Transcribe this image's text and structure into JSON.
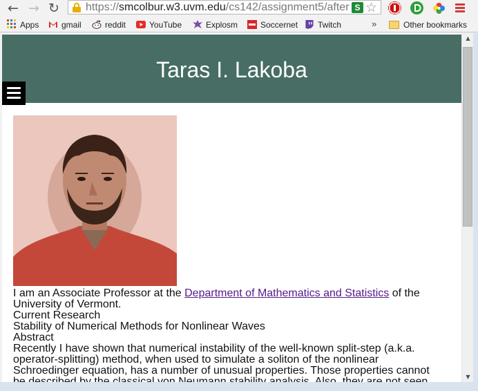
{
  "browser": {
    "url_scheme": "https://",
    "url_host": "smcolbur.w3.uvm.edu",
    "url_path": "/cs142/assignment5/after",
    "ext_green_label": "S",
    "icons": {
      "back": "back-arrow-icon",
      "forward": "forward-arrow-icon",
      "reload": "reload-icon",
      "lock": "lock-icon",
      "star": "star-icon"
    }
  },
  "bookmarks": {
    "items": [
      {
        "label": "Apps",
        "icon": "apps-grid-icon"
      },
      {
        "label": "gmail",
        "icon": "gmail-icon"
      },
      {
        "label": "reddit",
        "icon": "reddit-icon"
      },
      {
        "label": "YouTube",
        "icon": "youtube-icon"
      },
      {
        "label": "Explosm",
        "icon": "explosm-icon"
      },
      {
        "label": "Soccernet",
        "icon": "soccernet-icon"
      },
      {
        "label": "Twitch",
        "icon": "twitch-icon"
      }
    ],
    "overflow": "»",
    "other": "Other bookmarks"
  },
  "page": {
    "title": "Taras I. Lakoba",
    "intro_before": "I am an Associate Professor at the ",
    "intro_link": "Department of Mathematics and Statistics",
    "intro_after": " of the University of Vermont.",
    "heading_research": "Current Research",
    "research_title": "Stability of Numerical Methods for Nonlinear Waves",
    "heading_abstract": "Abstract",
    "abstract": "Recently I have shown that numerical instability of the well-known split-step (a.k.a. operator-splitting) method, when used to simulate a soliton of the nonlinear Schroedinger equation, has a number of unusual properties. Those properties cannot be described by the classical von Neumann stability analysis. Also, they are not seen"
  },
  "colors": {
    "header_bg": "#476d65",
    "link": "#551a8b"
  }
}
